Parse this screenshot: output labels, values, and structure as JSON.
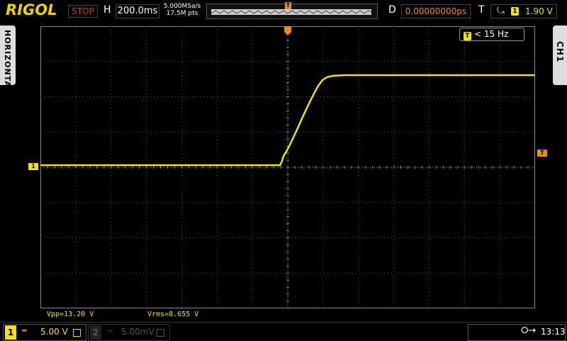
{
  "brand": "RIGOL",
  "top": {
    "run_state": "STOP",
    "h_label": "H",
    "timebase": "200.0ms",
    "sample_rate": "5.000MSa/s",
    "memory_depth": "17.5M pts",
    "trigger_pos_marker": "T",
    "d_label": "D",
    "delay": "0.00000000ps",
    "t_label": "T",
    "trigger_edge": "rising-edge-icon",
    "trigger_source": "1",
    "trigger_level": "1.90 V"
  },
  "side": {
    "left_tab": "HORIZONTAL",
    "right_tab": "CH1"
  },
  "screen": {
    "freq_marker": "T",
    "freq_value": "< 15 Hz",
    "ch1_marker": "1",
    "trig_level_marker": "T"
  },
  "measurements": {
    "vpp": "Vpp=13.20 V",
    "vrms": "Vrms=8.655 V"
  },
  "bottom": {
    "ch1": {
      "num": "1",
      "coupling": "═",
      "scale": "5.00 V"
    },
    "ch2": {
      "num": "2",
      "coupling": "~",
      "scale": "5.00mV"
    },
    "usb": "usb-icon",
    "time": "13:13"
  },
  "colors": {
    "ch1": "#f0e020",
    "trigger": "#f08a10",
    "stop": "#e23030",
    "grid": "#666666"
  }
}
